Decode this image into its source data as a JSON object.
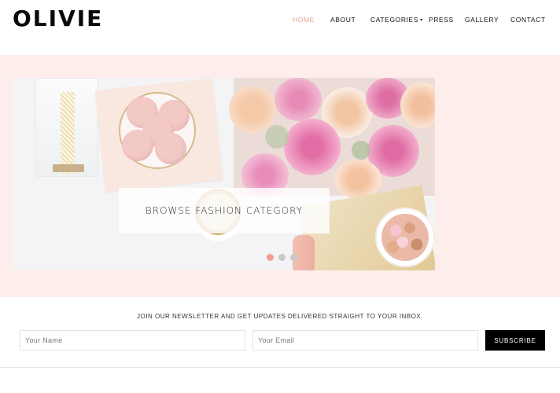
{
  "brand": {
    "logo": "OLIVIE",
    "accent": "#e8a393",
    "hero_bg": "#fdeeeb"
  },
  "nav": {
    "items": [
      {
        "label": "HOME",
        "active": true
      },
      {
        "label": "ABOUT",
        "active": false
      },
      {
        "label": "CATEGORIES",
        "active": false,
        "has_dropdown": true,
        "caret": "▾"
      },
      {
        "label": "PRESS",
        "active": false
      },
      {
        "label": "GALLERY",
        "active": false
      },
      {
        "label": "CONTACT",
        "active": false
      }
    ]
  },
  "slider": {
    "caption": "BROWSE FASHION CATEGORY",
    "slide_count": 3,
    "active_slide": 1,
    "image_description": "flat-lay with macarons, tape dispenser, pink roses, gold coins, confetti bowl"
  },
  "newsletter": {
    "text": "JOIN OUR NEWSLETTER AND GET UPDATES DELIVERED STRAIGHT TO YOUR INBOX.",
    "name_placeholder": "Your Name",
    "email_placeholder": "Your Email",
    "button_label": "SUBSCRIBE"
  }
}
